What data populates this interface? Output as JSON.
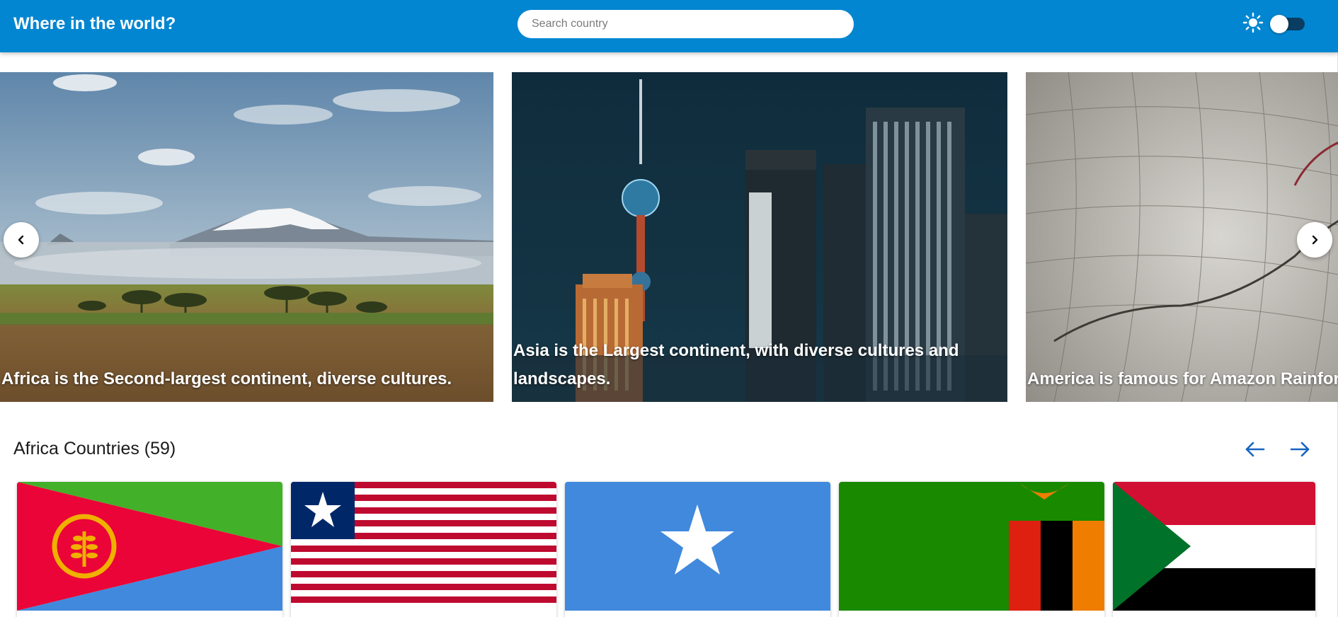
{
  "header": {
    "title": "Where in the world?",
    "search_placeholder": "Search country",
    "theme_icon": "sun-icon",
    "theme_toggle": "off"
  },
  "carousel": {
    "prev_icon": "chevron-left-icon",
    "next_icon": "chevron-right-icon",
    "slides": [
      {
        "continent": "Africa",
        "caption": "Africa is the Second-largest continent, diverse cultures."
      },
      {
        "continent": "Asia",
        "caption": "Asia is the Largest continent, with diverse cultures and landscapes."
      },
      {
        "continent": "America",
        "caption": "America is famous for Amazon Rainforest, and vast plains."
      }
    ]
  },
  "section": {
    "title": "Africa Countries (59)",
    "prev_icon": "arrow-left-icon",
    "next_icon": "arrow-right-icon"
  },
  "countries": [
    {
      "flag": "Eritrea"
    },
    {
      "flag": "Liberia"
    },
    {
      "flag": "Somalia"
    },
    {
      "flag": "Zambia"
    },
    {
      "flag": "Sudan"
    }
  ],
  "colors": {
    "header_bg": "#0286d1",
    "accent": "#1565c0",
    "text": "#1b1b1b"
  }
}
